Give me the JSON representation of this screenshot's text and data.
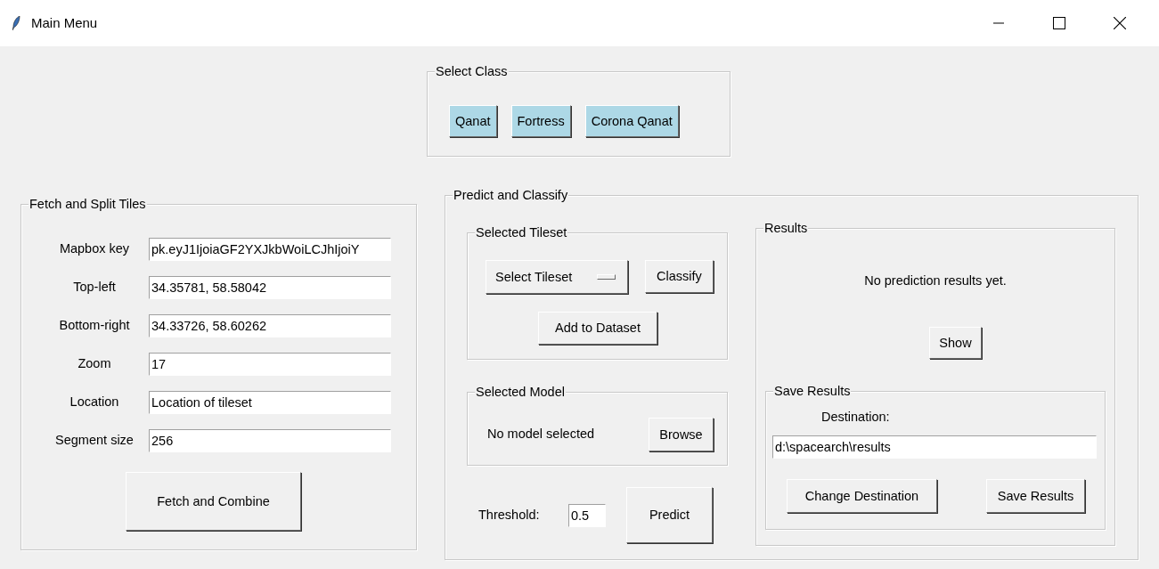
{
  "window": {
    "title": "Main Menu"
  },
  "select_class": {
    "title": "Select Class",
    "buttons": [
      "Qanat",
      "Fortress",
      "Corona Qanat"
    ]
  },
  "fetch": {
    "title": "Fetch and Split Tiles",
    "fields": [
      {
        "label": "Mapbox key",
        "value": "pk.eyJ1IjoiaGF2YXJkbWoiLCJhIjoiY"
      },
      {
        "label": "Top-left",
        "value": "34.35781, 58.58042"
      },
      {
        "label": "Bottom-right",
        "value": "34.33726, 58.60262"
      },
      {
        "label": "Zoom",
        "value": "17"
      },
      {
        "label": "Location",
        "value": "Location of tileset"
      },
      {
        "label": "Segment size",
        "value": "256"
      }
    ],
    "button": "Fetch and Combine"
  },
  "predict": {
    "title": "Predict and Classify",
    "tileset": {
      "title": "Selected Tileset",
      "dropdown": "Select Tileset",
      "classify": "Classify",
      "add": "Add to Dataset"
    },
    "model": {
      "title": "Selected Model",
      "status": "No model selected",
      "browse": "Browse"
    },
    "threshold": {
      "label": "Threshold:",
      "value": "0.5"
    },
    "predict_button": "Predict",
    "results": {
      "title": "Results",
      "message": "No prediction results yet.",
      "show": "Show",
      "save": {
        "title": "Save Results",
        "destination_label": "Destination:",
        "destination": "d:\\spacearch\\results",
        "change": "Change Destination",
        "save": "Save Results"
      }
    }
  }
}
